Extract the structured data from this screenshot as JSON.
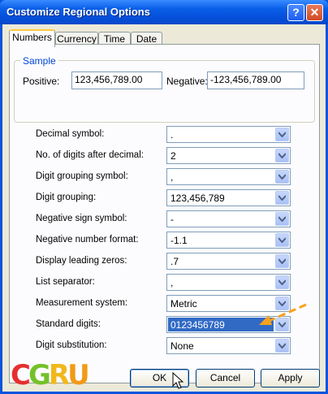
{
  "window": {
    "title": "Customize Regional Options",
    "help_label": "?",
    "close_label": "✕"
  },
  "tabs": [
    {
      "label": "Numbers",
      "active": true
    },
    {
      "label": "Currency",
      "active": false
    },
    {
      "label": "Time",
      "active": false
    },
    {
      "label": "Date",
      "active": false
    }
  ],
  "sample": {
    "title": "Sample",
    "positive_label": "Positive:",
    "positive_value": "123,456,789.00",
    "negative_label": "Negative:",
    "negative_value": "-123,456,789.00"
  },
  "settings": [
    {
      "label": "Decimal symbol:",
      "value": "."
    },
    {
      "label": "No. of digits after decimal:",
      "value": "2"
    },
    {
      "label": "Digit grouping symbol:",
      "value": ","
    },
    {
      "label": "Digit grouping:",
      "value": "123,456,789"
    },
    {
      "label": "Negative sign symbol:",
      "value": "-"
    },
    {
      "label": "Negative number format:",
      "value": "-1.1"
    },
    {
      "label": "Display leading zeros:",
      "value": ".7"
    },
    {
      "label": "List separator:",
      "value": ","
    },
    {
      "label": "Measurement system:",
      "value": "Metric"
    },
    {
      "label": "Standard digits:",
      "value": "0123456789",
      "selected": true
    },
    {
      "label": "Digit substitution:",
      "value": "None"
    }
  ],
  "buttons": {
    "ok": "OK",
    "cancel": "Cancel",
    "apply": "Apply"
  },
  "logo": {
    "text": "CGRU"
  },
  "colors": {
    "title_bar": "#0550dc",
    "selection": "#316ac5",
    "annotation_arrow": "#f7a21b",
    "sample_group_title": "#0046d5"
  }
}
